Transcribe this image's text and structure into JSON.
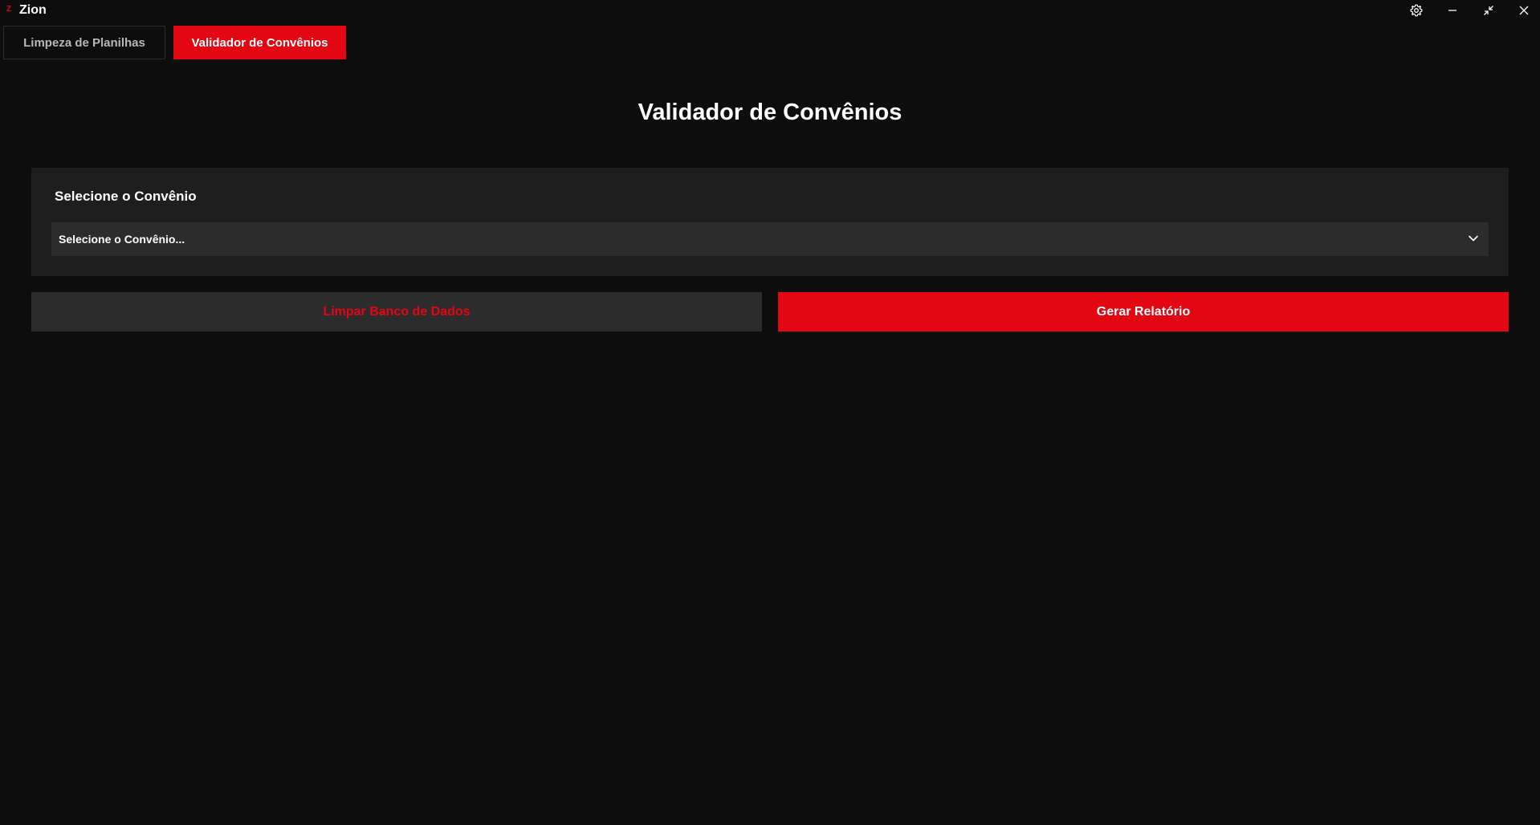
{
  "app": {
    "logo_letter": "Z",
    "name": "Zion"
  },
  "window_controls": {
    "settings_icon": "gear-icon",
    "minimize_icon": "minimize-icon",
    "restore_icon": "restore-icon",
    "close_icon": "close-icon"
  },
  "tabs": [
    {
      "label": "Limpeza de Planilhas",
      "active": false
    },
    {
      "label": "Validador de Convênios",
      "active": true
    }
  ],
  "main": {
    "title": "Validador de Convênios",
    "card": {
      "label": "Selecione o Convênio",
      "select": {
        "value": "Selecione o Convênio...",
        "icon": "chevron-down-icon"
      }
    },
    "buttons": {
      "clear_label": "Limpar Banco de Dados",
      "report_label": "Gerar Relatório"
    }
  },
  "colors": {
    "background": "#0d0d0e",
    "accent": "#e30613",
    "card": "#1e1e1f",
    "input": "#2c2c2d"
  }
}
